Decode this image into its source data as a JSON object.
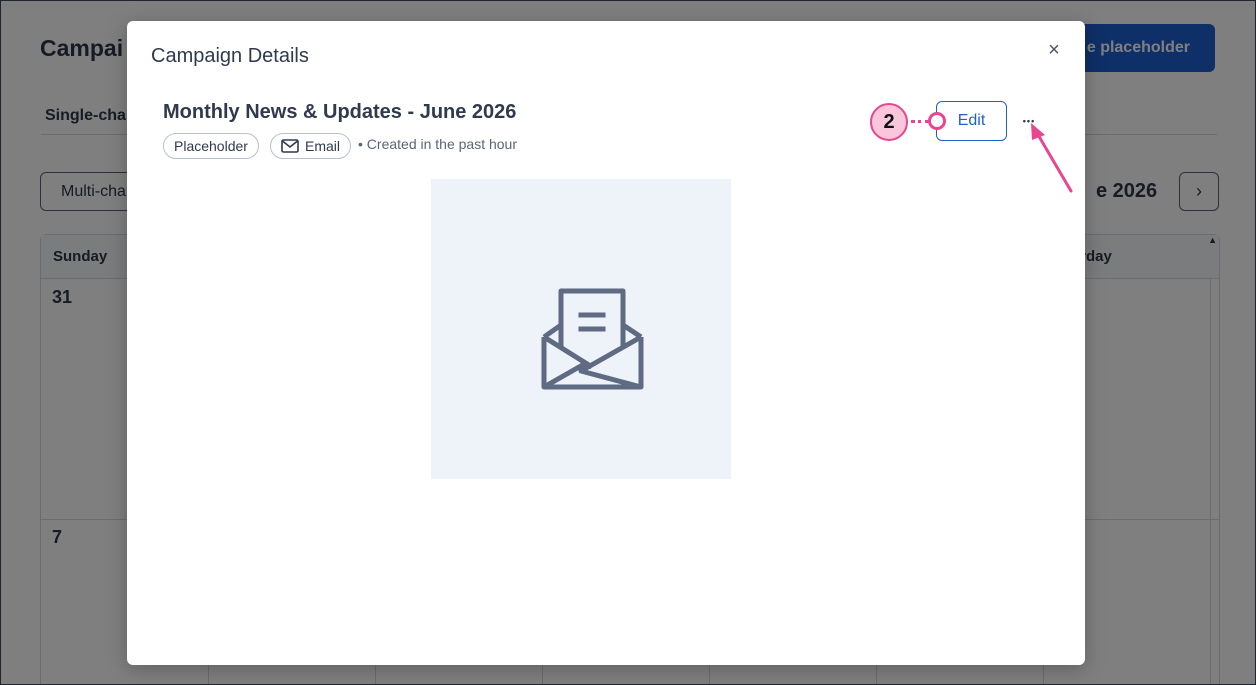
{
  "background": {
    "page_title": "Campai",
    "create_button_label": "e placeholder",
    "tab_label": "Single-cha",
    "dropdown_label": "Multi-cha",
    "month_label": "e 2026",
    "next_glyph": "›",
    "calendar": {
      "day_headers": [
        "Sunday",
        "urday"
      ],
      "dates": [
        "31",
        "7"
      ]
    }
  },
  "modal": {
    "title": "Campaign Details",
    "close_glyph": "×",
    "campaign_name": "Monthly News & Updates - June 2026",
    "tags": {
      "type": "Placeholder",
      "channel": "Email"
    },
    "meta_separator": "•",
    "meta_text": "Created in the past hour",
    "edit_label": "Edit",
    "more_glyph": "•••",
    "preview_icon": "open-envelope-icon"
  },
  "annotation": {
    "step_number": "2"
  },
  "colors": {
    "primary": "#1f5fd1",
    "overlay": "rgba(0,0,0,0.5)",
    "annotation_pink": "#e9468f",
    "annotation_fill": "#f9c6dc",
    "preview_bg": "#eef2f9",
    "icon_stroke": "#5f6b82"
  }
}
